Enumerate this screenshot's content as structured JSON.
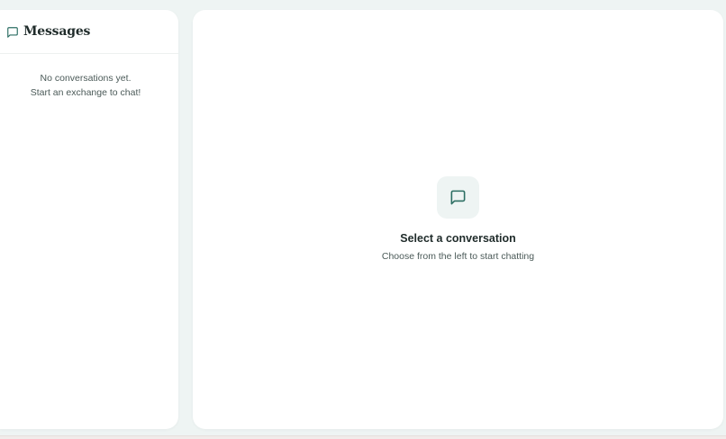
{
  "sidebar": {
    "title": "Messages",
    "icon": "message-square-icon",
    "empty_line1": "No conversations yet.",
    "empty_line2": "Start an exchange to chat!"
  },
  "main": {
    "icon": "message-square-icon",
    "empty_title": "Select a conversation",
    "empty_subtitle": "Choose from the left to start chatting"
  },
  "colors": {
    "accent": "#2c6e63",
    "background": "#eef4f3",
    "panel": "#ffffff",
    "text_primary": "#1f2b2a",
    "text_secondary": "#4b5a58"
  }
}
